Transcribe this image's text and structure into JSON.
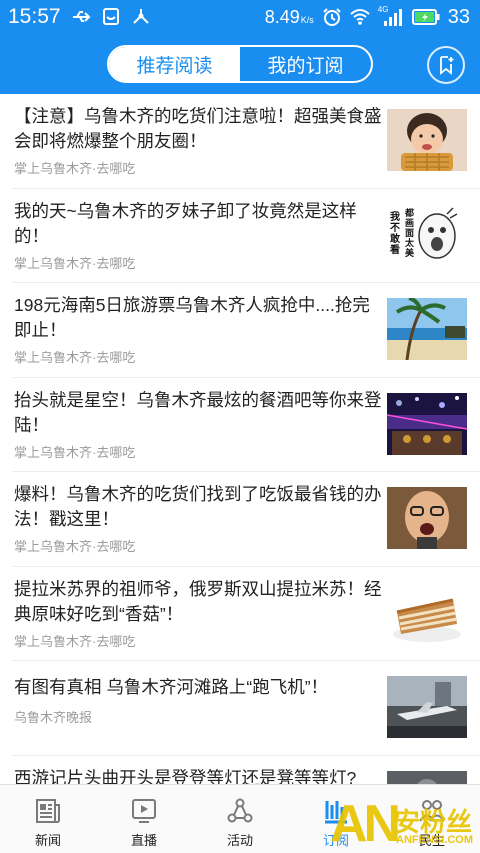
{
  "status": {
    "time": "15:57",
    "net_speed": "8.49",
    "net_unit": "K/s",
    "signal": "4G",
    "battery": "33"
  },
  "header": {
    "tabs": [
      {
        "label": "推荐阅读",
        "active": true
      },
      {
        "label": "我的订阅",
        "active": false
      }
    ],
    "bookmark_icon": "add-bookmark-icon"
  },
  "articles": [
    {
      "title": "【注意】乌鲁木齐的吃货们注意啦！超强美食盛会即将燃爆整个朋友圈！",
      "source": "掌上乌鲁木齐·去哪吃",
      "thumb": "girl-eating-waffle"
    },
    {
      "title": "我的天~乌鲁木齐的歹妹子卸了妆竟然是这样的！",
      "source": "掌上乌鲁木齐·去哪吃",
      "thumb": "meme-face"
    },
    {
      "title": "198元海南5日旅游票乌鲁木齐人疯抢中....抢完即止！",
      "source": "掌上乌鲁木齐·去哪吃",
      "thumb": "beach-palm"
    },
    {
      "title": "抬头就是星空！乌鲁木齐最炫的餐酒吧等你来登陆！",
      "source": "掌上乌鲁木齐·去哪吃",
      "thumb": "bar-lights"
    },
    {
      "title": "爆料！乌鲁木齐的吃货们找到了吃饭最省钱的办法！戳这里！",
      "source": "掌上乌鲁木齐·去哪吃",
      "thumb": "surprised-man"
    },
    {
      "title": "提拉米苏界的祖师爷，俄罗斯双山提拉米苏！经典原味好吃到“香菇”！",
      "source": "掌上乌鲁木齐·去哪吃",
      "thumb": "cake-slice"
    },
    {
      "title": "有图有真相 乌鲁木齐河滩路上“跑飞机”！",
      "source": "乌鲁木齐晚报",
      "thumb": "road-plane"
    },
    {
      "title": "西游记片头曲开头是登登等灯还是凳等等灯?",
      "source": "",
      "thumb": "blurry-photo"
    }
  ],
  "wordmeme": {
    "line1": "我不敢看",
    "line2": "都画面太美"
  },
  "tabbar": [
    {
      "label": "新闻",
      "icon": "newspaper-icon",
      "active": false
    },
    {
      "label": "直播",
      "icon": "play-screen-icon",
      "active": false
    },
    {
      "label": "活动",
      "icon": "network-nodes-icon",
      "active": false
    },
    {
      "label": "订阅",
      "icon": "bars-subscribe-icon",
      "active": true
    },
    {
      "label": "民生",
      "icon": "people-icon",
      "active": false
    }
  ],
  "watermark": {
    "text_big": "AN",
    "text_cn": "安粉丝",
    "domain": "ANFENSI.COM"
  },
  "colors": {
    "brand": "#1a8ef0",
    "watermark": "#e8c400"
  }
}
